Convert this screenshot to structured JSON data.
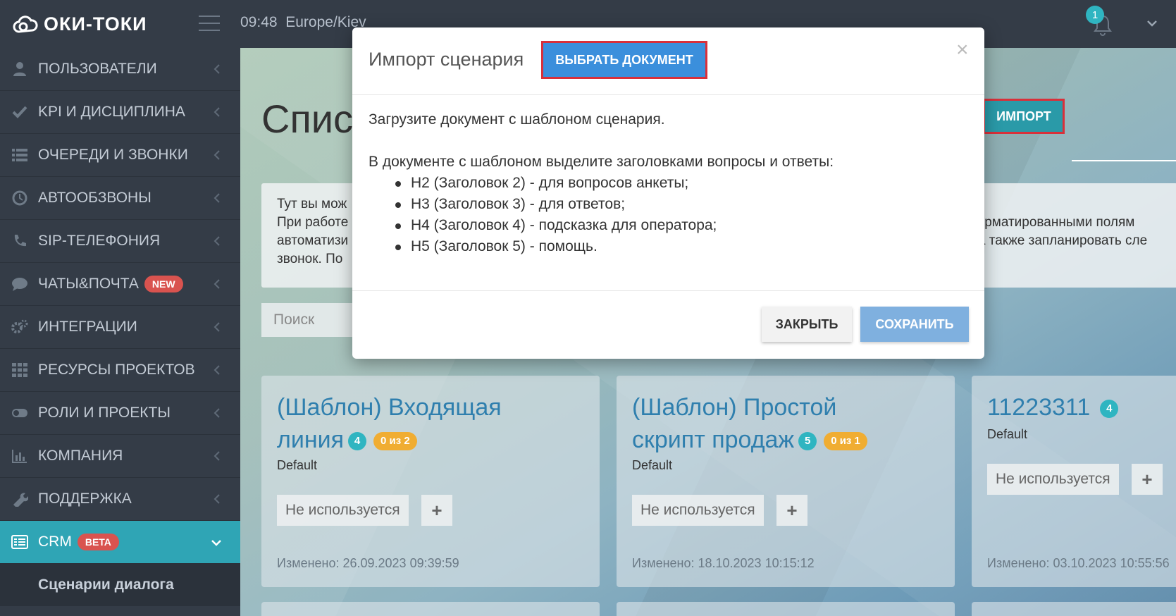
{
  "topbar": {
    "logo_text": "ОКИ-ТОКИ",
    "time": "09:48",
    "timezone": "Europe/Kiev",
    "notifications_count": "1"
  },
  "sidebar": {
    "items": [
      {
        "label": "ПОЛЬЗОВАТЕЛИ",
        "icon": "user-icon"
      },
      {
        "label": "KPI И ДИСЦИПЛИНА",
        "icon": "check-icon"
      },
      {
        "label": "ОЧЕРЕДИ И ЗВОНКИ",
        "icon": "list-icon"
      },
      {
        "label": "АВТООБЗВОНЫ",
        "icon": "clock-icon"
      },
      {
        "label": "SIP-ТЕЛЕФОНИЯ",
        "icon": "phone-icon"
      },
      {
        "label": "ЧАТЫ&ПОЧТА",
        "icon": "chat-icon",
        "badge": "NEW"
      },
      {
        "label": "ИНТЕГРАЦИИ",
        "icon": "gears-icon"
      },
      {
        "label": "РЕСУРСЫ ПРОЕКТОВ",
        "icon": "grid-icon"
      },
      {
        "label": "РОЛИ И ПРОЕКТЫ",
        "icon": "toggle-icon"
      },
      {
        "label": "КОМПАНИЯ",
        "icon": "bar-chart-icon"
      },
      {
        "label": "ПОДДЕРЖКА",
        "icon": "wrench-icon"
      },
      {
        "label": "CRM",
        "icon": "crm-icon",
        "badge": "BETA"
      }
    ],
    "sub_item": "Сценарии диалога"
  },
  "main": {
    "page_title": "Спис",
    "import_label": "ИМПОРТ",
    "info_left": [
      "Тут вы мож",
      "При работе",
      "автоматизи",
      "звонок. По"
    ],
    "info_right": [
      "форматированными полям",
      "), а также запланировать сле"
    ],
    "search_placeholder": "Поиск",
    "cards": [
      {
        "title_1": "(Шаблон) Входящая",
        "title_2": "линия",
        "count": "4",
        "progress": "0 из 2",
        "project": "Default",
        "status": "Не используется",
        "modified": "Изменено: 26.09.2023 09:39:59"
      },
      {
        "title_1": "(Шаблон) Простой",
        "title_2": "скрипт продаж",
        "count": "5",
        "progress": "0 из 1",
        "project": "Default",
        "status": "Не используется",
        "modified": "Изменено: 18.10.2023 10:15:12"
      },
      {
        "title_1": "11223311",
        "count": "4",
        "project": "Default",
        "status": "Не используется",
        "modified": "Изменено: 03.10.2023 10:55:56"
      }
    ]
  },
  "modal": {
    "title": "Импорт сценария",
    "choose_label": "ВЫБРАТЬ ДОКУМЕНТ",
    "close_symbol": "×",
    "intro": "Загрузите документ с шаблоном сценария.",
    "instructions": "В документе с шаблоном выделите заголовками вопросы и ответы:",
    "list": [
      "H2 (Заголовок 2) - для вопросов анкеты;",
      "H3 (Заголовок 3) - для ответов;",
      "H4 (Заголовок 4) - подсказка для оператора;",
      "H5 (Заголовок 5) - помощь."
    ],
    "close_label": "ЗАКРЫТЬ",
    "save_label": "СОХРАНИТЬ"
  }
}
